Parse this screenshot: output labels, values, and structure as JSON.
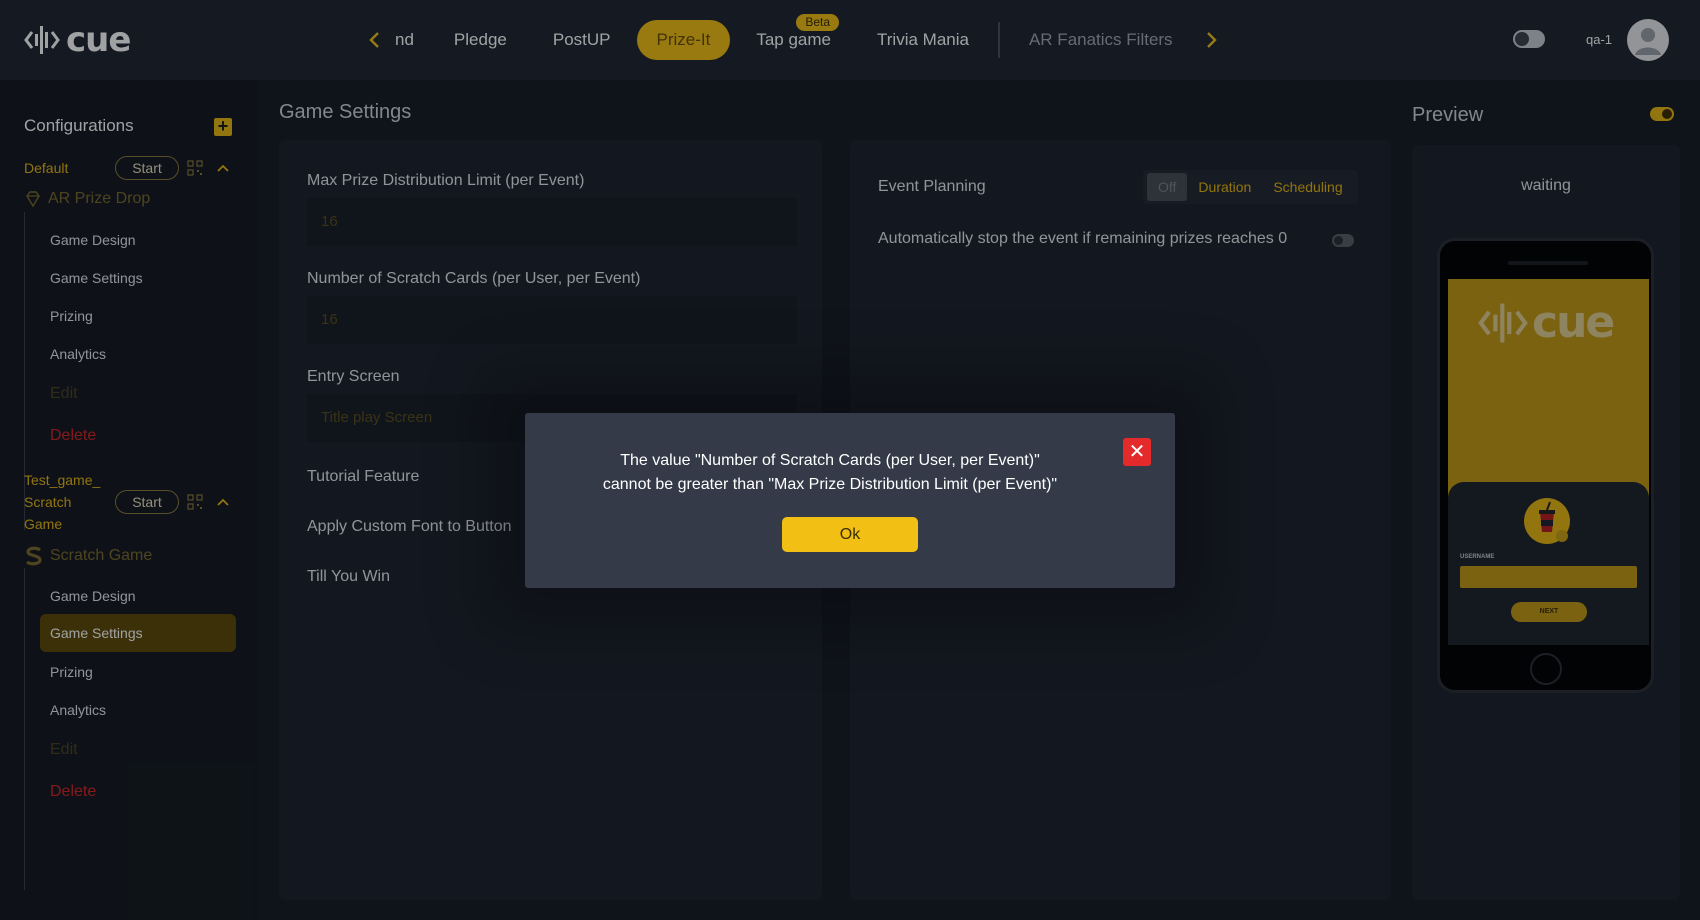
{
  "brand": {
    "name": "cue"
  },
  "nav": {
    "prev_icon": "chevron-left-icon",
    "next_icon": "chevron-right-icon",
    "tabs": [
      {
        "label": "nd"
      },
      {
        "label": "Pledge"
      },
      {
        "label": "PostUP"
      },
      {
        "label": "Prize-It",
        "active": true
      },
      {
        "label": "Tap game",
        "badge": "Beta"
      },
      {
        "label": "Trivia Mania"
      },
      {
        "label": "AR Fanatics Filters"
      }
    ]
  },
  "user": {
    "name": "qa-1"
  },
  "sidebar": {
    "title": "Configurations",
    "configs": [
      {
        "name": "Default",
        "start_label": "Start",
        "game_type": "AR Prize Drop",
        "items": [
          "Game Design",
          "Game Settings",
          "Prizing",
          "Analytics",
          "Edit",
          "Delete"
        ]
      },
      {
        "name_lines": [
          "Test_game_",
          "Scratch",
          "Game"
        ],
        "start_label": "Start",
        "game_type": "Scratch Game",
        "items": [
          "Game Design",
          "Game Settings",
          "Prizing",
          "Analytics",
          "Edit",
          "Delete"
        ],
        "selected": "Game Settings"
      }
    ]
  },
  "game_settings": {
    "title": "Game Settings",
    "fields": [
      {
        "label": "Max Prize Distribution Limit (per Event)",
        "value": "16"
      },
      {
        "label": "Number of Scratch Cards (per User, per Event)",
        "value": "16"
      },
      {
        "label": "Entry Screen",
        "placeholder": "Title play Screen"
      },
      {
        "label": "Tutorial Feature"
      },
      {
        "label": "Apply Custom Font to Button"
      },
      {
        "label": "Till You Win"
      }
    ]
  },
  "event_planning": {
    "label": "Event Planning",
    "options": [
      "Off",
      "Duration",
      "Scheduling"
    ],
    "selected": "Off",
    "auto_stop_label": "Automatically stop the event if remaining prizes reaches 0"
  },
  "preview": {
    "title": "Preview",
    "status": "waiting",
    "phone_brand": "cue",
    "username_label": "Username",
    "next_label": "Next"
  },
  "modal": {
    "message_lines": [
      "The value \"Number of Scratch Cards (per User, per Event)\"",
      "cannot be greater than \"Max Prize Distribution Limit (per Event)\""
    ],
    "ok_label": "Ok"
  },
  "colors": {
    "accent": "#f2c014",
    "danger": "#e42a2a",
    "background": "#161b23"
  }
}
